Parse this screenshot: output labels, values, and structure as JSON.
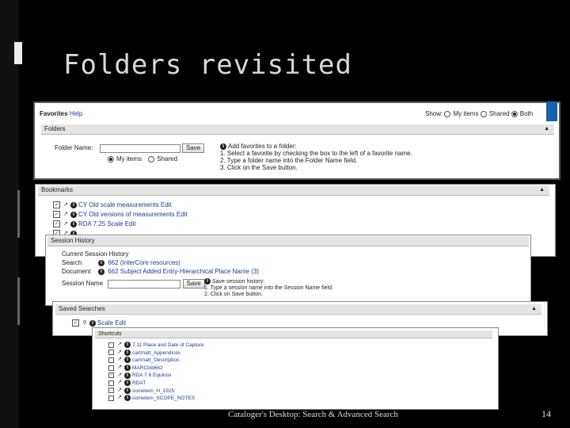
{
  "slide": {
    "title": "Folders revisited",
    "footer": "Cataloger's Desktop: Search & Advanced Search",
    "page_number": "14"
  },
  "favorites": {
    "title": "Favorites",
    "help": "Help",
    "show_label": "Show:",
    "show_options": [
      "My items",
      "Shared",
      "Both"
    ],
    "show_selected": "Both"
  },
  "folders": {
    "header": "Folders",
    "folder_name_label": "Folder Name:",
    "save_button": "Save",
    "scope_options": [
      "My items",
      "Shared"
    ],
    "scope_selected": "My items",
    "help_title": "Add favorites to a folder:",
    "help_steps": [
      "1. Select a favorite by checking the box to the left of a favorite name.",
      "2. Type a folder name into the Folder Name field.",
      "3. Click on the Save button."
    ]
  },
  "bookmarks": {
    "header": "Bookmarks",
    "items": [
      {
        "label": "CY Old scale measurements",
        "edit": "Edit"
      },
      {
        "label": "CY Old versions of measurements",
        "edit": "Edit"
      },
      {
        "label": "RDA 7.25 Scale",
        "edit": "Edit"
      },
      {
        "label": "",
        "edit": ""
      }
    ]
  },
  "session_history": {
    "header": "Session History",
    "current_label": "Current Session History",
    "search_label": "Search",
    "search_value": "662 (InterCore resources)",
    "document_label": "Document",
    "document_value": "662 Subject Added Entry-Hierarchical Place Name (3)",
    "session_name_label": "Session Name",
    "save_button": "Save",
    "help_title": "Save session history:",
    "help_steps": [
      "1. Type a session name into the Session Name field.",
      "2. Click on Save button."
    ]
  },
  "saved_searches": {
    "header": "Saved Searches",
    "items": [
      {
        "label": "Scale",
        "edit": "Edit"
      }
    ]
  },
  "shortcuts": {
    "header": "Shortcuts",
    "items": [
      "7.11 Place and Date of Capture",
      "cartmatt_Appendices",
      "cartmatt_Description",
      "MARCbib662",
      "RDA 7.6 Equinox",
      "RDAT",
      "sometem_H_1925",
      "sometem_SCOPE_NOTES"
    ],
    "checked_index": 4
  },
  "colors": {
    "background": "#000000",
    "title": "#d8d8d8",
    "link": "#1a3d9a",
    "accent": "#1a5fb0"
  }
}
